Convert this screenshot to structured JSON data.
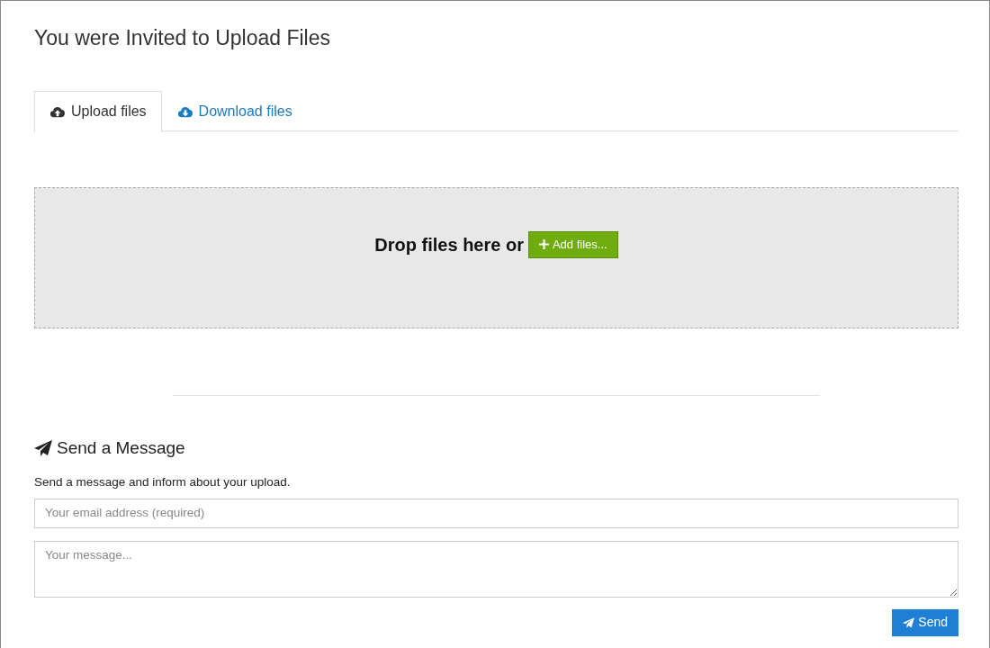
{
  "title": "You were Invited to Upload Files",
  "tabs": [
    {
      "label": "Upload files",
      "kind": "upload",
      "selected": true
    },
    {
      "label": "Download files",
      "kind": "download",
      "selected": false
    }
  ],
  "dropzone": {
    "text": "Drop files here or",
    "button": "Add files..."
  },
  "message": {
    "heading": "Send a Message",
    "description": "Send a message and inform about your upload.",
    "email": {
      "placeholder": "Your email address (required)"
    },
    "body": {
      "placeholder": "Your message..."
    },
    "button": "Send"
  }
}
